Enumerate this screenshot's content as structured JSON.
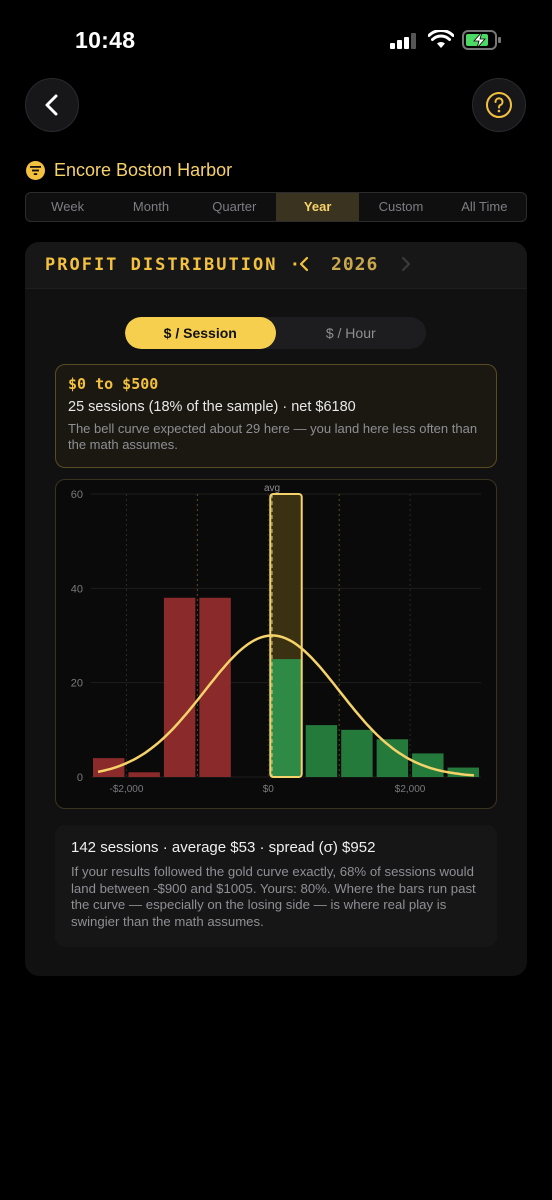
{
  "status_bar": {
    "time": "10:48"
  },
  "venue": {
    "name": "Encore Boston Harbor"
  },
  "tabs": [
    {
      "label": "Week"
    },
    {
      "label": "Month"
    },
    {
      "label": "Quarter"
    },
    {
      "label": "Year"
    },
    {
      "label": "Custom"
    },
    {
      "label": "All Time"
    }
  ],
  "active_tab": "Year",
  "card": {
    "title": "PROFIT DISTRIBUTION ·",
    "year": "2026"
  },
  "toggle": {
    "session_label": "$ / Session",
    "hour_label": "$ / Hour",
    "active": "$ / Session"
  },
  "selected_bin": {
    "range": "$0 to $500",
    "detail": "25 sessions (18% of the sample) · net $6180",
    "note": "The bell curve expected about 29 here — you land here less often than the math assumes."
  },
  "summary": {
    "headline": "142 sessions · average $53 · spread (σ) $952",
    "body": "If your results followed the gold curve exactly, 68% of sessions would land between -$900 and $1005. Yours: 80%. Where the bars run past the curve — especially on the losing side — is where real play is swingier than the math assumes."
  },
  "colors": {
    "accent": "#f4c13f",
    "loss": "#8b2a2a",
    "win": "#247a3a",
    "curve": "#f6d26a"
  },
  "chart_data": {
    "type": "bar",
    "bin_width": 500,
    "bins": [
      {
        "from": -2500,
        "to": -2000,
        "count": 4
      },
      {
        "from": -2000,
        "to": -1500,
        "count": 1
      },
      {
        "from": -1500,
        "to": -1000,
        "count": 38
      },
      {
        "from": -1000,
        "to": -500,
        "count": 38
      },
      {
        "from": 0,
        "to": 500,
        "count": 25,
        "selected": true
      },
      {
        "from": 500,
        "to": 1000,
        "count": 11
      },
      {
        "from": 1000,
        "to": 1500,
        "count": 10
      },
      {
        "from": 1500,
        "to": 2000,
        "count": 8
      },
      {
        "from": 2000,
        "to": 2500,
        "count": 5
      },
      {
        "from": 2500,
        "to": 3000,
        "count": 2
      }
    ],
    "curve": {
      "mean": 53,
      "sigma": 952,
      "n": 142,
      "peak": 30
    },
    "xlim": [
      -2500,
      3000
    ],
    "ylim": [
      0,
      60
    ],
    "yticks": [
      "0",
      "20",
      "40",
      "60"
    ],
    "ytick_values": [
      0,
      20,
      40,
      60
    ],
    "xticks": [
      "-$2,000",
      "$0",
      "$2,000"
    ],
    "xtick_values": [
      -2000,
      0,
      2000
    ],
    "avg_label": "avg",
    "reference_lines": [
      -2000,
      -1000,
      0,
      1000,
      2000
    ]
  }
}
